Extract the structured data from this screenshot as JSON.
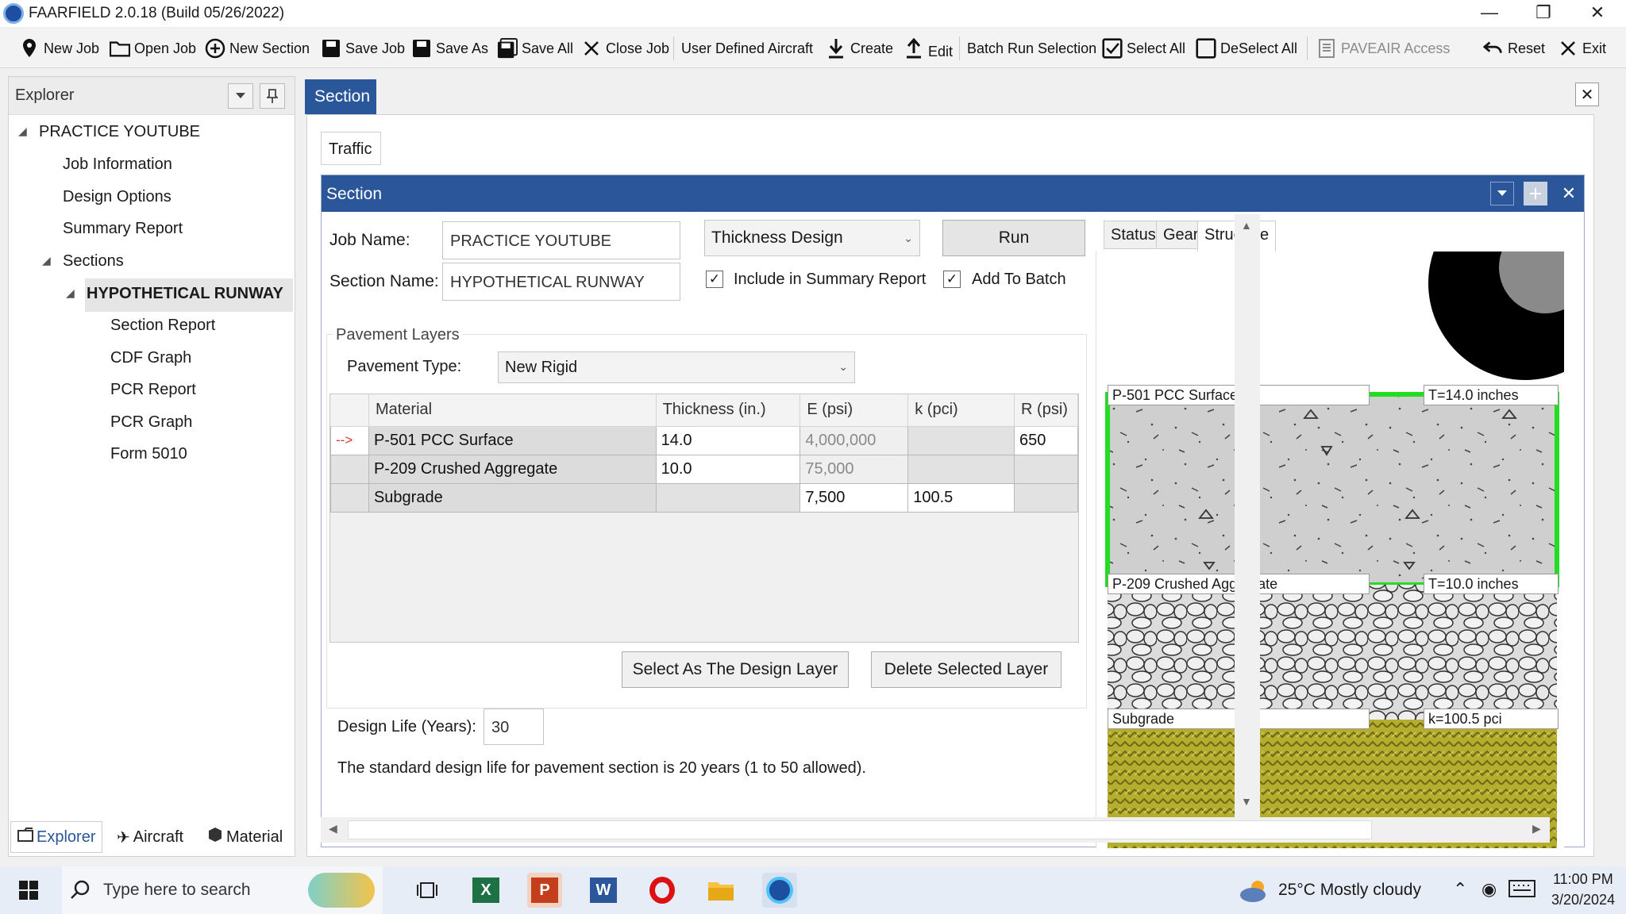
{
  "window": {
    "title": "FAARFIELD 2.0.18 (Build 05/26/2022)"
  },
  "toolbar": {
    "new_job": "New Job",
    "open_job": "Open Job",
    "new_section": "New Section",
    "save_job": "Save Job",
    "save_as": "Save As",
    "save_all": "Save All",
    "close_job": "Close Job",
    "user_defined_aircraft": "User Defined Aircraft",
    "create": "Create",
    "edit": "Edit",
    "batch_run_selection": "Batch Run Selection",
    "select_all": "Select All",
    "deselect_all": "DeSelect All",
    "paveair_access": "PAVEAIR Access",
    "reset": "Reset",
    "exit": "Exit"
  },
  "explorer": {
    "title": "Explorer",
    "tree": {
      "job": "PRACTICE YOUTUBE",
      "job_information": "Job Information",
      "design_options": "Design Options",
      "summary_report": "Summary Report",
      "sections": "Sections",
      "section": "HYPOTHETICAL RUNWAY",
      "section_report": "Section Report",
      "cdf_graph": "CDF Graph",
      "pcr_report": "PCR Report",
      "pcr_graph": "PCR Graph",
      "form_5010": "Form 5010"
    },
    "tabs": {
      "explorer": "Explorer",
      "aircraft": "Aircraft",
      "material": "Material"
    }
  },
  "document": {
    "tab": "Section",
    "traffic_tab": "Traffic"
  },
  "section_panel": {
    "title": "Section",
    "job_name_label": "Job Name:",
    "job_name": "PRACTICE YOUTUBE",
    "section_name_label": "Section Name:",
    "section_name": "HYPOTHETICAL RUNWAY",
    "mode": "Thickness Design",
    "run": "Run",
    "include_summary": "Include in Summary Report",
    "add_to_batch": "Add To Batch",
    "pavement_layers": "Pavement Layers",
    "pavement_type_label": "Pavement Type:",
    "pavement_type": "New Rigid",
    "grid": {
      "columns": [
        "Material",
        "Thickness (in.)",
        "E (psi)",
        "k (pci)",
        "R (psi)"
      ],
      "rows": [
        {
          "marker": "-->",
          "material": "P-501 PCC Surface",
          "thickness": "14.0",
          "e": "4,000,000",
          "k": "",
          "r": "650"
        },
        {
          "marker": "",
          "material": "P-209 Crushed Aggregate",
          "thickness": "10.0",
          "e": "75,000",
          "k": "",
          "r": ""
        },
        {
          "marker": "",
          "material": "Subgrade",
          "thickness": "",
          "e": "7,500",
          "k": "100.5",
          "r": ""
        }
      ]
    },
    "select_design_layer": "Select As The Design Layer",
    "delete_layer": "Delete Selected Layer",
    "design_life_label": "Design Life (Years):",
    "design_life": "30",
    "design_life_note": "The standard design life for pavement section is 20 years (1 to 50 allowed).",
    "structure_tabs": {
      "status": "Status",
      "gear": "Gear",
      "structure": "Structure"
    },
    "structure": {
      "layer1_name": "P-501 PCC Surface",
      "layer1_t": "T=14.0 inches",
      "layer2_name": "P-209 Crushed Aggregate",
      "layer2_t": "T=10.0 inches",
      "layer3_name": "Subgrade",
      "layer3_k": "k=100.5 pci"
    }
  },
  "taskbar": {
    "search_placeholder": "Type here to search",
    "weather": "25°C  Mostly cloudy",
    "time": "11:00 PM",
    "date": "3/20/2024"
  }
}
